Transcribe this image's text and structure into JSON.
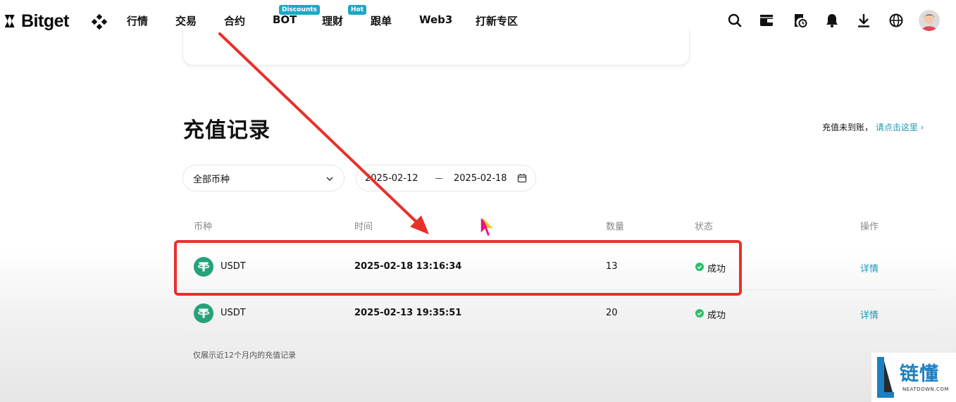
{
  "brand": {
    "name": "Bitget"
  },
  "nav": {
    "items": [
      {
        "label": "行情"
      },
      {
        "label": "交易"
      },
      {
        "label": "合约"
      },
      {
        "label": "BOT",
        "badge": "Discounts"
      },
      {
        "label": "理财",
        "badge": "Hot"
      },
      {
        "label": "跟单"
      },
      {
        "label": "Web3"
      },
      {
        "label": "打新专区"
      }
    ]
  },
  "header_icons": [
    "search-icon",
    "wallet-icon",
    "orders-icon",
    "bell-icon",
    "download-icon",
    "globe-icon",
    "avatar"
  ],
  "page": {
    "title": "充值记录",
    "not_arrived_text": "充值未到账，",
    "not_arrived_link": "请点击这里 ›"
  },
  "filters": {
    "coin_select_value": "全部币种",
    "date_start": "2025-02-12",
    "date_end": "2025-02-18"
  },
  "table": {
    "columns": {
      "coin": "币种",
      "time": "时间",
      "amount": "数量",
      "status": "状态",
      "action": "操作"
    },
    "rows": [
      {
        "coin": "USDT",
        "time": "2025-02-18 13:16:34",
        "amount": "13",
        "status": "成功",
        "action": "详情"
      },
      {
        "coin": "USDT",
        "time": "2025-02-13 19:35:51",
        "amount": "20",
        "status": "成功",
        "action": "详情"
      }
    ],
    "footnote": "仅展示近12个月内的充值记录"
  },
  "colors": {
    "accent": "#1a9bb8",
    "badge": "#1ea7c4",
    "usdt": "#26a17b",
    "success": "#2cbe6a",
    "annotation_red": "#e8302a"
  },
  "watermark": {
    "text": "链懂",
    "subtext": "NEATDOWN.COM"
  }
}
